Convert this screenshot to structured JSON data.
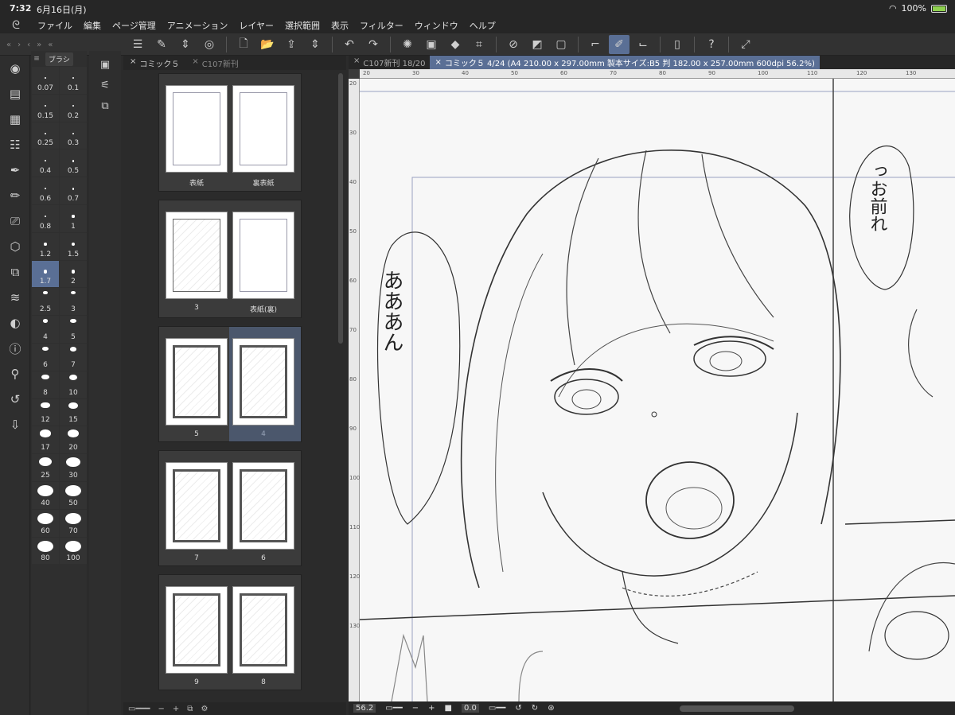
{
  "status": {
    "time": "7:32",
    "date": "6月16日(月)",
    "battery": "100%"
  },
  "menu": [
    "ファイル",
    "編集",
    "ページ管理",
    "アニメーション",
    "レイヤー",
    "選択範囲",
    "表示",
    "フィルター",
    "ウィンドウ",
    "ヘルプ"
  ],
  "brush_panel": {
    "tab_label": "ブラシ",
    "sizes": [
      "0.07",
      "0.1",
      "0.15",
      "0.2",
      "0.25",
      "0.3",
      "0.4",
      "0.5",
      "0.6",
      "0.7",
      "0.8",
      "1",
      "1.2",
      "1.5",
      "1.7",
      "2",
      "2.5",
      "3",
      "4",
      "5",
      "6",
      "7",
      "8",
      "10",
      "12",
      "15",
      "17",
      "20",
      "25",
      "30",
      "40",
      "50",
      "60",
      "70",
      "80",
      "100"
    ],
    "selected": "1.7"
  },
  "page_panel": {
    "tabs": [
      "コミック５",
      "C107新刊"
    ],
    "spreads": [
      {
        "labels": [
          "表紙",
          "裏表紙"
        ],
        "style": "blank"
      },
      {
        "labels": [
          "3",
          "表紙(裏)"
        ],
        "style": "sketch-blank"
      },
      {
        "labels": [
          "5",
          "4"
        ],
        "style": "sketch",
        "selected_right": true
      },
      {
        "labels": [
          "7",
          "6"
        ],
        "style": "sketch"
      },
      {
        "labels": [
          "9",
          "8"
        ],
        "style": "sketch"
      }
    ]
  },
  "canvas": {
    "tabs": [
      "C107新刊 18/20",
      "コミック５ 4/24 (A4 210.00 x 297.00mm 製本サイズ:B5 判 182.00 x 257.00mm 600dpi 56.2%)"
    ],
    "zoom": "56.2",
    "rotation": "0.0",
    "ruler_top": [
      "20",
      "30",
      "40",
      "50",
      "60",
      "70",
      "80",
      "90",
      "100",
      "110",
      "120",
      "130"
    ],
    "ruler_left": [
      "20",
      "30",
      "40",
      "50",
      "60",
      "70",
      "80",
      "90",
      "100",
      "110",
      "120",
      "130"
    ],
    "speech_left": "あああん",
    "speech_right": "っお前れ"
  },
  "colors": {
    "accent": "#5a6f95",
    "panel": "#2f2f2f",
    "bar": "#262626"
  }
}
